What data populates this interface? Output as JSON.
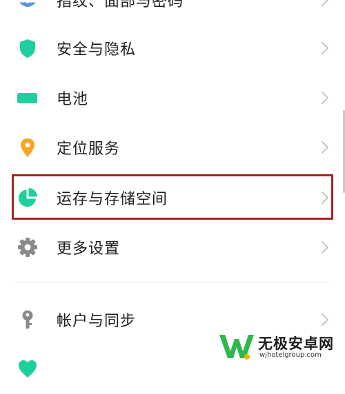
{
  "colors": {
    "accent": "#1fcf9d",
    "location": "#f5a623",
    "gray_icon": "#8a8a8a",
    "highlight_border": "#a2231d",
    "chevron": "#c6c6c6",
    "watermark_green": "#2db84c"
  },
  "settings": {
    "items": [
      {
        "label": "指纹、面部与密码",
        "icon": "fingerprint-icon"
      },
      {
        "label": "安全与隐私",
        "icon": "shield-icon"
      },
      {
        "label": "电池",
        "icon": "battery-icon"
      },
      {
        "label": "定位服务",
        "icon": "location-pin-icon"
      },
      {
        "label": "运存与存储空间",
        "icon": "storage-pie-icon"
      },
      {
        "label": "更多设置",
        "icon": "gear-icon"
      },
      {
        "label": "帐户与同步",
        "icon": "key-icon"
      },
      {
        "label": "",
        "icon": "heart-icon"
      }
    ]
  },
  "watermark": {
    "title": "无极安卓网",
    "url": "wjhotelgroup.com"
  }
}
